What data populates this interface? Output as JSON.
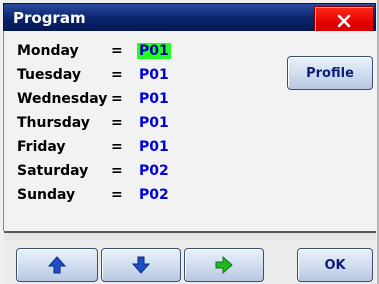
{
  "window": {
    "title": "Program"
  },
  "schedule": [
    {
      "day": "Monday",
      "equals": "=",
      "program": "P01",
      "selected": true
    },
    {
      "day": "Tuesday",
      "equals": "=",
      "program": "P01",
      "selected": false
    },
    {
      "day": "Wednesday",
      "equals": "=",
      "program": "P01",
      "selected": false
    },
    {
      "day": "Thursday",
      "equals": "=",
      "program": "P01",
      "selected": false
    },
    {
      "day": "Friday",
      "equals": "=",
      "program": "P01",
      "selected": false
    },
    {
      "day": "Saturday",
      "equals": "=",
      "program": "P02",
      "selected": false
    },
    {
      "day": "Sunday",
      "equals": "=",
      "program": "P02",
      "selected": false
    }
  ],
  "buttons": {
    "profile_label": "Profile",
    "ok_label": "OK"
  },
  "icons": {
    "close": "close-icon",
    "up": "arrow-up-icon",
    "down": "arrow-down-icon",
    "right": "arrow-right-icon"
  },
  "colors": {
    "titlebar": "#0a246a",
    "close_button": "#e40000",
    "selection_highlight": "#22ff22",
    "program_text": "#0000dd",
    "arrow_blue": "#1f4fc8",
    "arrow_green": "#22b822"
  }
}
